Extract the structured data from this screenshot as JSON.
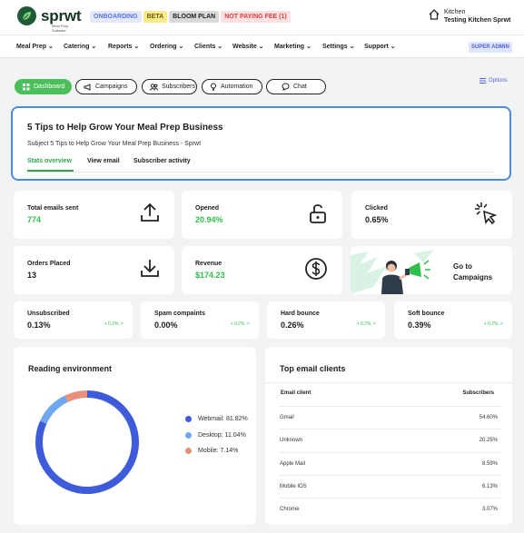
{
  "header": {
    "brand": "sprwt",
    "brand_sub": "Meal Prep Software",
    "badges": {
      "onboarding": "ONBOARDING",
      "beta": "BETA",
      "plan": "BLOOM PLAN",
      "not_paying": "NOT PAYING FEE (1)"
    },
    "kitchen_label": "Kitchen",
    "kitchen_name": "Testing Kitchen Sprwt",
    "super_admin": "SUPER ADMIN"
  },
  "nav": [
    "Meal Prep",
    "Catering",
    "Reports",
    "Ordering",
    "Clients",
    "Website",
    "Marketing",
    "Settings",
    "Support"
  ],
  "tabs": [
    "Dashboard",
    "Campaigns",
    "Subscribers",
    "Automation",
    "Chat"
  ],
  "options_label": "Options",
  "email": {
    "title": "5 Tips to Help Grow Your Meal Prep Business",
    "subject": "Subject 5 Tips to Help Grow Your Meal Prep Business - Sprwt",
    "subtabs": [
      "Stats overview",
      "View email",
      "Subscriber activity"
    ]
  },
  "stats": {
    "total_sent": {
      "label": "Total emails sent",
      "value": "774"
    },
    "opened": {
      "label": "Opened",
      "value": "20.94%"
    },
    "clicked": {
      "label": "Clicked",
      "value": "0.65%"
    },
    "orders": {
      "label": "Orders Placed",
      "value": "13"
    },
    "revenue": {
      "label": "Revenue",
      "value": "$174.23"
    },
    "goto_campaigns": "Go to Campaigns"
  },
  "mini_stats": [
    {
      "label": "Unsubscribed",
      "value": "0.13%",
      "trend": "+ 0.2%"
    },
    {
      "label": "Spam compaints",
      "value": "0.00%",
      "trend": "+ 0.2%"
    },
    {
      "label": "Hard bounce",
      "value": "0.26%",
      "trend": "+ 0.2%"
    },
    {
      "label": "Soft bounce",
      "value": "0.39%",
      "trend": "+ 0.2%"
    }
  ],
  "reading": {
    "title": "Reading environment",
    "legend": [
      "Webmail: 81.82%",
      "Desktop: 11.04%",
      "Mobile: 7.14%"
    ],
    "values": [
      81.82,
      11.04,
      7.14
    ],
    "colors": [
      "#3e5bd9",
      "#6fa8ee",
      "#e9907c"
    ]
  },
  "clients": {
    "title": "Top email clients",
    "col_client": "Email client",
    "col_subs": "Subscribers",
    "rows": [
      {
        "name": "Gmail",
        "value": "54.60%"
      },
      {
        "name": "Unknown",
        "value": "20.25%"
      },
      {
        "name": "Apple Mail",
        "value": "8.59%"
      },
      {
        "name": "Mobile IOS",
        "value": "6.13%"
      },
      {
        "name": "Chrome",
        "value": "3.07%"
      }
    ]
  }
}
